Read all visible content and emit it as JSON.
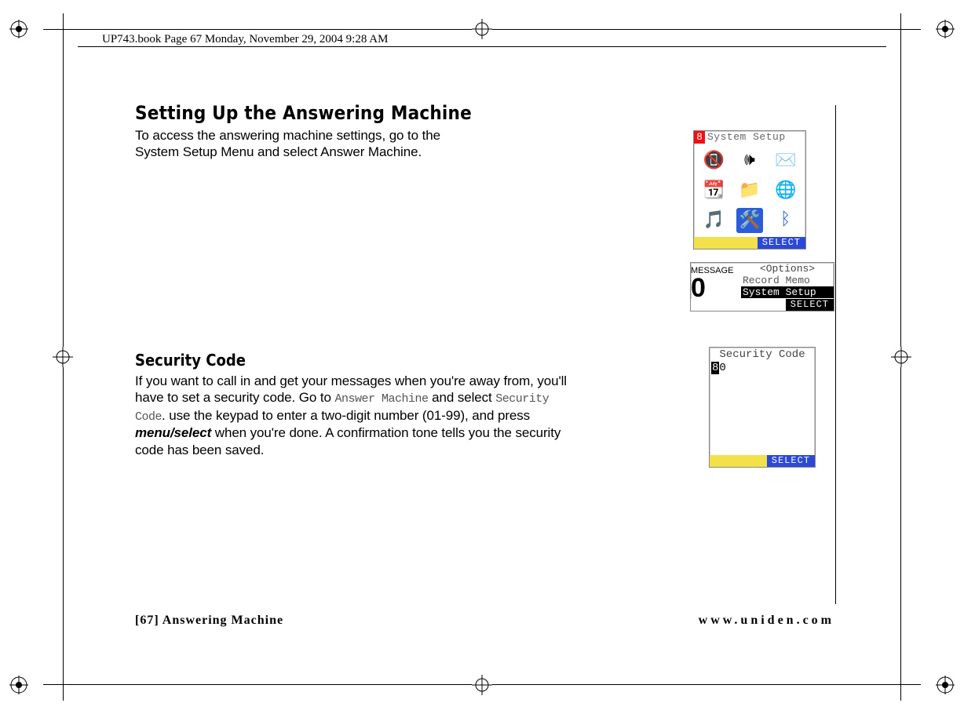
{
  "book_header": "UP743.book  Page 67  Monday, November 29, 2004  9:28 AM",
  "section1": {
    "title": "Setting Up the Answering Machine",
    "body": "To access the answering machine settings, go to the System Setup Menu and select Answer Machine."
  },
  "section2": {
    "title": "Security Code",
    "body_pre": "If you want to call in and get your messages when you're away from, you'll have to set a security code. Go to ",
    "lcd1": "Answer Machine",
    "body_mid1": " and select ",
    "lcd2": "Security Code",
    "body_mid2": ". use the keypad to enter a two-digit number (01-99), and press ",
    "em": "menu/select",
    "body_post": " when you're done. A confirmation tone tells you the security code has been saved."
  },
  "screen1": {
    "num": "8",
    "title": "System Setup",
    "select": "SELECT"
  },
  "screen2": {
    "label": "MESSAGE",
    "digit": "0",
    "options_hdr": "<Options>",
    "row1": "Record Memo",
    "row2": "System Setup",
    "select": "SELECT"
  },
  "screen3": {
    "hdr": "Security Code",
    "cursor": "8",
    "rest": "0",
    "select": "SELECT"
  },
  "footer": {
    "left": "[67] Answering Machine",
    "right": "www.uniden.com"
  }
}
